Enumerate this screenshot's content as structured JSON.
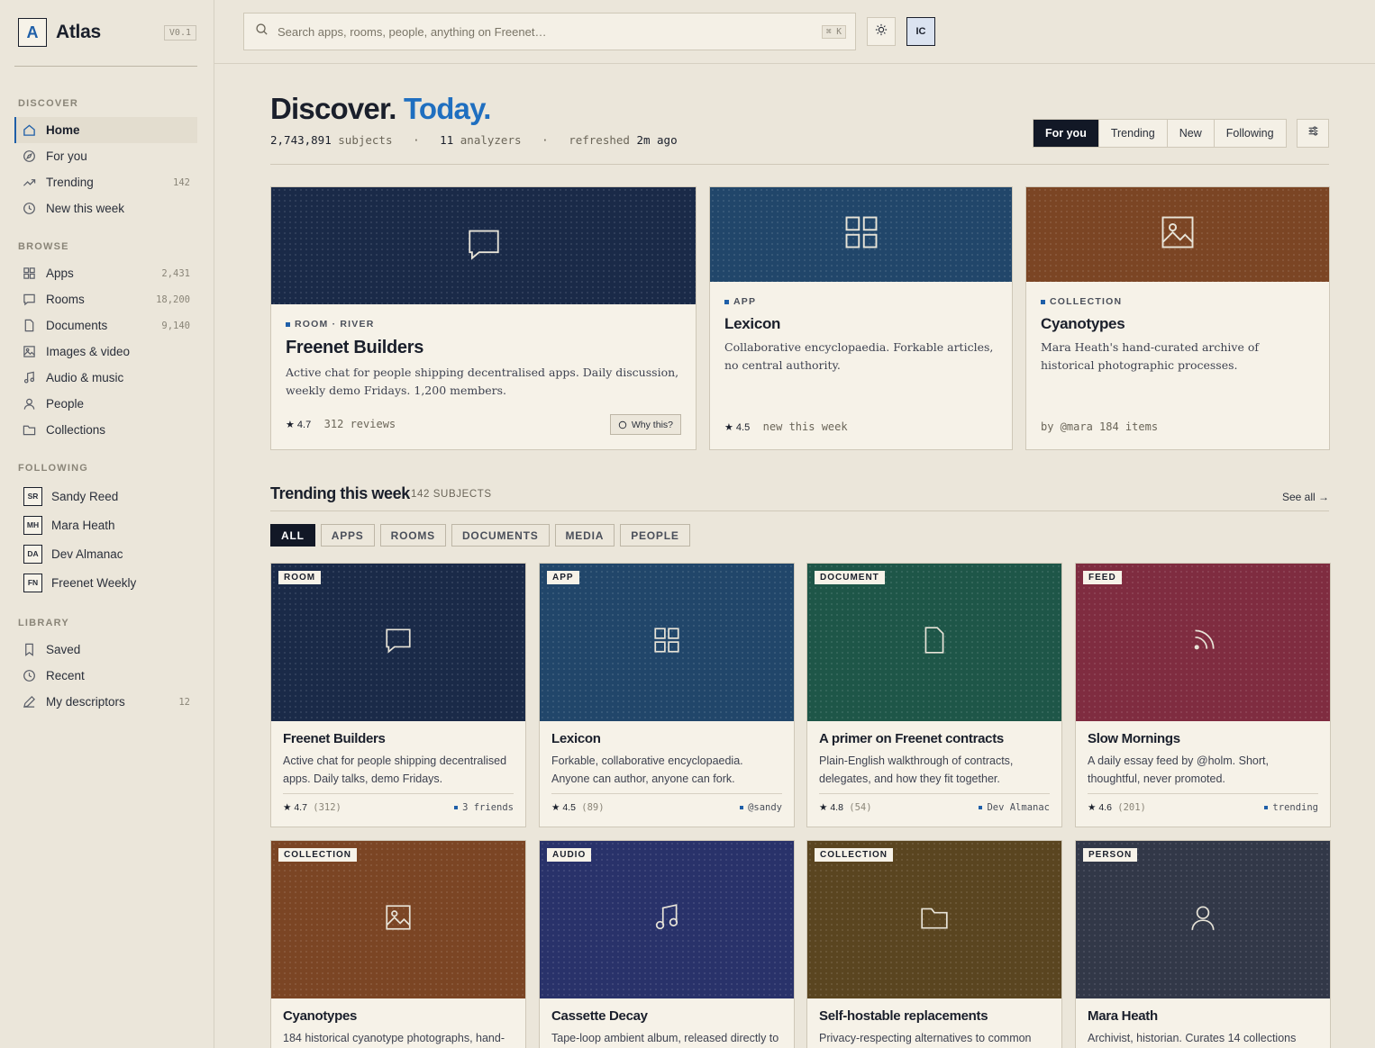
{
  "brand": {
    "logo": "A",
    "name": "Atlas",
    "version": "V0.1"
  },
  "sidebar": {
    "discover": {
      "heading": "DISCOVER",
      "items": [
        {
          "label": "Home",
          "icon": "home-icon"
        },
        {
          "label": "For you",
          "icon": "compass-icon"
        },
        {
          "label": "Trending",
          "icon": "trend-icon",
          "count": "142"
        },
        {
          "label": "New this week",
          "icon": "clock-icon"
        }
      ]
    },
    "browse": {
      "heading": "BROWSE",
      "items": [
        {
          "label": "Apps",
          "icon": "grid-icon",
          "count": "2,431"
        },
        {
          "label": "Rooms",
          "icon": "chat-icon",
          "count": "18,200"
        },
        {
          "label": "Documents",
          "icon": "document-icon",
          "count": "9,140"
        },
        {
          "label": "Images & video",
          "icon": "image-icon"
        },
        {
          "label": "Audio & music",
          "icon": "music-icon"
        },
        {
          "label": "People",
          "icon": "person-icon"
        },
        {
          "label": "Collections",
          "icon": "folder-icon"
        }
      ]
    },
    "following": {
      "heading": "FOLLOWING",
      "items": [
        {
          "initials": "SR",
          "label": "Sandy Reed"
        },
        {
          "initials": "MH",
          "label": "Mara Heath"
        },
        {
          "initials": "DA",
          "label": "Dev Almanac"
        },
        {
          "initials": "FN",
          "label": "Freenet Weekly"
        }
      ]
    },
    "library": {
      "heading": "LIBRARY",
      "items": [
        {
          "label": "Saved",
          "icon": "bookmark-icon"
        },
        {
          "label": "Recent",
          "icon": "clock-icon"
        },
        {
          "label": "My descriptors",
          "icon": "pen-icon",
          "count": "12"
        }
      ]
    }
  },
  "topbar": {
    "search_placeholder": "Search apps, rooms, people, anything on Freenet…",
    "shortcut": "⌘ K",
    "user_initials": "IC"
  },
  "hero": {
    "title": "Discover.",
    "title_accent": "Today.",
    "subjects": "2,743,891",
    "subjects_label": "subjects",
    "analyzers": "11",
    "analyzers_label": "analyzers",
    "refreshed_label": "refreshed",
    "refreshed": "2m ago",
    "sep": "·"
  },
  "tabs": [
    "For you",
    "Trending",
    "New",
    "Following"
  ],
  "featured": [
    {
      "kind": "ROOM · RIVER",
      "title": "Freenet Builders",
      "desc": "Active chat for people shipping decentralised apps. Daily discussion, weekly demo Fridays. 1,200 members.",
      "rating": "★ 4.7",
      "meta": "312 reviews",
      "why": "Why this?",
      "color": "#1a2a48"
    },
    {
      "kind": "APP",
      "title": "Lexicon",
      "desc": "Collaborative encyclopaedia. Forkable articles, no central authority.",
      "rating": "★ 4.5",
      "meta": "new this week",
      "color": "#21466a"
    },
    {
      "kind": "COLLECTION",
      "title": "Cyanotypes",
      "desc": "Mara Heath's hand-curated archive of historical photographic processes.",
      "rating": "",
      "meta": "by @mara  184 items",
      "color": "#7b4524"
    }
  ],
  "trending": {
    "title": "Trending this week",
    "count": "142 SUBJECTS",
    "see_all": "See all →",
    "chips": [
      "ALL",
      "APPS",
      "ROOMS",
      "DOCUMENTS",
      "MEDIA",
      "PEOPLE"
    ],
    "cards": [
      {
        "badge": "ROOM",
        "title": "Freenet Builders",
        "desc": "Active chat for people shipping decentralised apps. Daily talks, demo Fridays.",
        "rating": "★ 4.7",
        "reviews": "(312)",
        "tag": "3 friends",
        "color": "#1a2a48",
        "icon": "chat-icon"
      },
      {
        "badge": "APP",
        "title": "Lexicon",
        "desc": "Forkable, collaborative encyclopaedia. Anyone can author, anyone can fork.",
        "rating": "★ 4.5",
        "reviews": "(89)",
        "tag": "@sandy",
        "color": "#21466a",
        "icon": "grid-icon"
      },
      {
        "badge": "DOCUMENT",
        "title": "A primer on Freenet contracts",
        "desc": "Plain-English walkthrough of contracts, delegates, and how they fit together.",
        "rating": "★ 4.8",
        "reviews": "(54)",
        "tag": "Dev Almanac",
        "color": "#1e5648",
        "icon": "document-icon"
      },
      {
        "badge": "FEED",
        "title": "Slow Mornings",
        "desc": "A daily essay feed by @holm. Short, thoughtful, never promoted.",
        "rating": "★ 4.6",
        "reviews": "(201)",
        "tag": "trending",
        "color": "#7f2c40",
        "icon": "rss-icon"
      },
      {
        "badge": "COLLECTION",
        "title": "Cyanotypes",
        "desc": "184 historical cyanotype photographs, hand-",
        "color": "#7b4524",
        "icon": "image-icon"
      },
      {
        "badge": "AUDIO",
        "title": "Cassette Decay",
        "desc": "Tape-loop ambient album, released directly to",
        "color": "#29326a",
        "icon": "music-icon"
      },
      {
        "badge": "COLLECTION",
        "title": "Self-hostable replacements",
        "desc": "Privacy-respecting alternatives to common",
        "color": "#5a4520",
        "icon": "folder-icon"
      },
      {
        "badge": "PERSON",
        "title": "Mara Heath",
        "desc": "Archivist, historian. Curates 14 collections",
        "color": "#323848",
        "icon": "person-icon"
      }
    ]
  }
}
